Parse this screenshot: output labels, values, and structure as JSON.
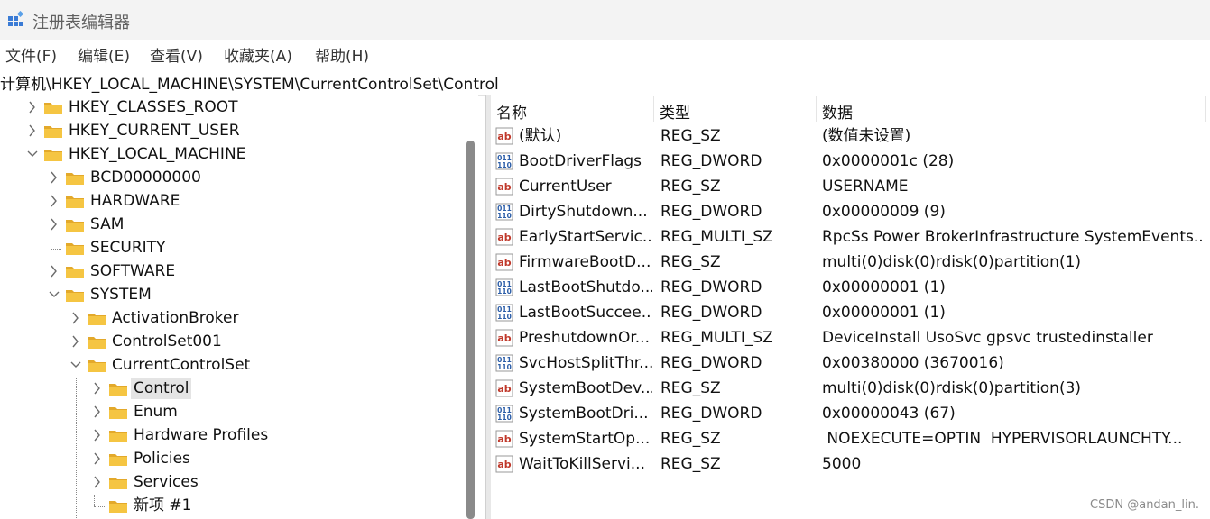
{
  "window": {
    "title": "注册表编辑器",
    "icon": "regedit-icon"
  },
  "menu": [
    "文件(F)",
    "编辑(E)",
    "查看(V)",
    "收藏夹(A)",
    "帮助(H)"
  ],
  "address": "计算机\\HKEY_LOCAL_MACHINE\\SYSTEM\\CurrentControlSet\\Control",
  "tree": [
    {
      "label": "HKEY_CLASSES_ROOT",
      "level": 0,
      "expander": "collapsed"
    },
    {
      "label": "HKEY_CURRENT_USER",
      "level": 0,
      "expander": "collapsed"
    },
    {
      "label": "HKEY_LOCAL_MACHINE",
      "level": 0,
      "expander": "expanded"
    },
    {
      "label": "BCD00000000",
      "level": 1,
      "expander": "collapsed"
    },
    {
      "label": "HARDWARE",
      "level": 1,
      "expander": "collapsed"
    },
    {
      "label": "SAM",
      "level": 1,
      "expander": "collapsed"
    },
    {
      "label": "SECURITY",
      "level": 1,
      "expander": "none"
    },
    {
      "label": "SOFTWARE",
      "level": 1,
      "expander": "collapsed"
    },
    {
      "label": "SYSTEM",
      "level": 1,
      "expander": "expanded"
    },
    {
      "label": "ActivationBroker",
      "level": 2,
      "expander": "collapsed"
    },
    {
      "label": "ControlSet001",
      "level": 2,
      "expander": "collapsed"
    },
    {
      "label": "CurrentControlSet",
      "level": 2,
      "expander": "expanded"
    },
    {
      "label": "Control",
      "level": 3,
      "expander": "collapsed",
      "selected": true
    },
    {
      "label": "Enum",
      "level": 3,
      "expander": "collapsed"
    },
    {
      "label": "Hardware Profiles",
      "level": 3,
      "expander": "collapsed"
    },
    {
      "label": "Policies",
      "level": 3,
      "expander": "collapsed"
    },
    {
      "label": "Services",
      "level": 3,
      "expander": "collapsed"
    },
    {
      "label": "新项 #1",
      "level": 3,
      "expander": "none"
    }
  ],
  "columns": {
    "name": "名称",
    "type": "类型",
    "data": "数据"
  },
  "values": [
    {
      "icon": "string",
      "name": "(默认)",
      "type": "REG_SZ",
      "data": "(数值未设置)"
    },
    {
      "icon": "binary",
      "name": "BootDriverFlags",
      "type": "REG_DWORD",
      "data": "0x0000001c (28)"
    },
    {
      "icon": "string",
      "name": "CurrentUser",
      "type": "REG_SZ",
      "data": "USERNAME"
    },
    {
      "icon": "binary",
      "name": "DirtyShutdown...",
      "type": "REG_DWORD",
      "data": "0x00000009 (9)"
    },
    {
      "icon": "string",
      "name": "EarlyStartServic...",
      "type": "REG_MULTI_SZ",
      "data": "RpcSs Power BrokerInfrastructure SystemEvents..."
    },
    {
      "icon": "string",
      "name": "FirmwareBootD...",
      "type": "REG_SZ",
      "data": "multi(0)disk(0)rdisk(0)partition(1)"
    },
    {
      "icon": "binary",
      "name": "LastBootShutdo...",
      "type": "REG_DWORD",
      "data": "0x00000001 (1)"
    },
    {
      "icon": "binary",
      "name": "LastBootSuccee...",
      "type": "REG_DWORD",
      "data": "0x00000001 (1)"
    },
    {
      "icon": "string",
      "name": "PreshutdownOr...",
      "type": "REG_MULTI_SZ",
      "data": "DeviceInstall UsoSvc gpsvc trustedinstaller"
    },
    {
      "icon": "binary",
      "name": "SvcHostSplitThr...",
      "type": "REG_DWORD",
      "data": "0x00380000 (3670016)"
    },
    {
      "icon": "string",
      "name": "SystemBootDev...",
      "type": "REG_SZ",
      "data": "multi(0)disk(0)rdisk(0)partition(3)"
    },
    {
      "icon": "binary",
      "name": "SystemBootDri...",
      "type": "REG_DWORD",
      "data": "0x00000043 (67)"
    },
    {
      "icon": "string",
      "name": "SystemStartOp...",
      "type": "REG_SZ",
      "data": " NOEXECUTE=OPTIN  HYPERVISORLAUNCHTY..."
    },
    {
      "icon": "string",
      "name": "WaitToKillServi...",
      "type": "REG_SZ",
      "data": "5000"
    }
  ],
  "watermark": "CSDN @andan_lin.",
  "colors": {
    "folder": "#f5c542",
    "folder_dark": "#e3a92b",
    "string_icon": "#c0392b",
    "binary_icon": "#2b5da8"
  }
}
